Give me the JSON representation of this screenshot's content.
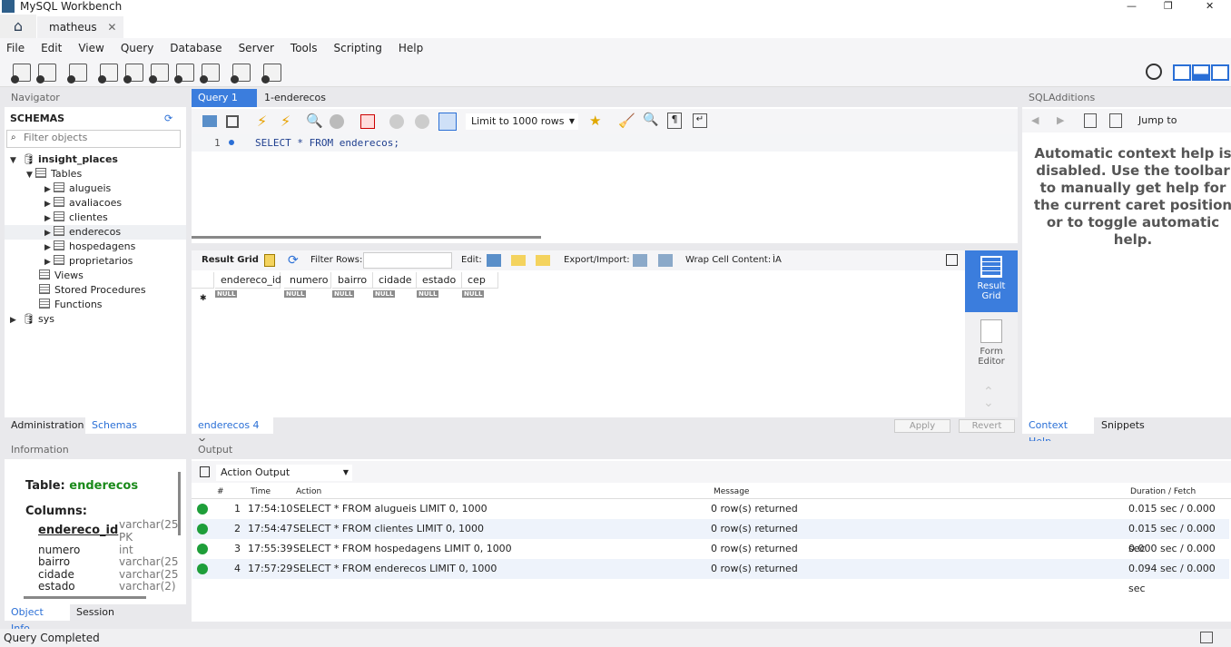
{
  "window": {
    "title": "MySQL Workbench",
    "minimize": "—",
    "maximize": "❐",
    "close": "✕"
  },
  "connection_tab": {
    "label": "matheus",
    "close": "✕"
  },
  "menu": [
    "File",
    "Edit",
    "View",
    "Query",
    "Database",
    "Server",
    "Tools",
    "Scripting",
    "Help"
  ],
  "navigator": {
    "title": "Navigator",
    "schemas_label": "SCHEMAS",
    "filter_placeholder": "Filter objects",
    "schema": "insight_places",
    "tables_label": "Tables",
    "tables": [
      "alugueis",
      "avaliacoes",
      "clientes",
      "enderecos",
      "hospedagens",
      "proprietarios"
    ],
    "selected_table": "enderecos",
    "views": "Views",
    "procedures": "Stored Procedures",
    "functions": "Functions",
    "other_schema": "sys",
    "tabs": [
      "Administration",
      "Schemas"
    ]
  },
  "editor": {
    "tabs": [
      "Query 1",
      "1-enderecos"
    ],
    "limit": "Limit to 1000 rows",
    "line_number": "1",
    "sql": "SELECT * FROM enderecos;"
  },
  "results": {
    "result_grid": "Result Grid",
    "filter_rows": "Filter Rows:",
    "edit": "Edit:",
    "export_import": "Export/Import:",
    "wrap": "Wrap Cell Content:",
    "columns": [
      "endereco_id",
      "numero",
      "bairro",
      "cidade",
      "estado",
      "cep"
    ],
    "null": "NULL",
    "side": {
      "result_grid": "Result Grid",
      "form_editor": "Form Editor"
    },
    "tab": "enderecos 4",
    "apply": "Apply",
    "revert": "Revert"
  },
  "sql_additions": {
    "title": "SQLAdditions",
    "jump_to": "Jump to",
    "help": "Automatic context help is disabled. Use the toolbar to manually get help for the current caret position or to toggle automatic help.",
    "tabs": [
      "Context Help",
      "Snippets"
    ]
  },
  "information": {
    "title": "Information",
    "table_label": "Table:",
    "table": "enderecos",
    "columns_label": "Columns:",
    "columns": [
      {
        "name": "endereco_id",
        "type": "varchar(25",
        "pk": "PK"
      },
      {
        "name": "numero",
        "type": "int"
      },
      {
        "name": "bairro",
        "type": "varchar(25"
      },
      {
        "name": "cidade",
        "type": "varchar(25"
      },
      {
        "name": "estado",
        "type": "varchar(2)"
      }
    ],
    "tabs": [
      "Object Info",
      "Session"
    ]
  },
  "output": {
    "title": "Output",
    "selector": "Action Output",
    "headers": [
      "#",
      "Time",
      "Action",
      "Message",
      "Duration / Fetch"
    ],
    "rows": [
      {
        "n": "1",
        "time": "17:54:10",
        "action": "SELECT * FROM alugueis LIMIT 0, 1000",
        "message": "0 row(s) returned",
        "duration": "0.015 sec / 0.000 sec",
        "status": "ok"
      },
      {
        "n": "2",
        "time": "17:54:47",
        "action": "SELECT * FROM clientes LIMIT 0, 1000",
        "message": "0 row(s) returned",
        "duration": "0.015 sec / 0.000 sec",
        "status": "ok"
      },
      {
        "n": "3",
        "time": "17:55:39",
        "action": "SELECT * FROM hospedagens LIMIT 0, 1000",
        "message": "0 row(s) returned",
        "duration": "0.000 sec / 0.000 sec",
        "status": "ok"
      },
      {
        "n": "4",
        "time": "17:57:29",
        "action": "SELECT * FROM enderecos LIMIT 0, 1000",
        "message": "0 row(s) returned",
        "duration": "0.094 sec / 0.000 sec",
        "status": "ok"
      }
    ]
  },
  "status_bar": "Query Completed",
  "colors": {
    "accent": "#3478d8",
    "active_tab": "#3b7ddd",
    "ok": "#1e9e3a",
    "green_text": "#1a8a1a"
  }
}
